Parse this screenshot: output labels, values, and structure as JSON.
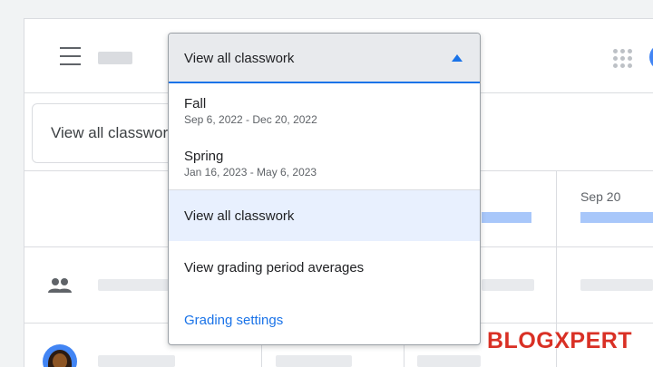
{
  "filter": {
    "label": "View all classwork"
  },
  "dropdown": {
    "selected": "View all classwork",
    "options": [
      {
        "label": "Fall",
        "dates": "Sep 6, 2022 - Dec 20, 2022"
      },
      {
        "label": "Spring",
        "dates": "Jan 16, 2023 - May 6, 2023"
      }
    ],
    "view_all": "View all classwork",
    "view_averages": "View grading period averages",
    "settings": "Grading settings"
  },
  "grid": {
    "column_date": "Sep 20"
  },
  "icons": {
    "menu": "hamburger-menu-icon",
    "apps": "apps-grid-icon",
    "caret": "caret-up-icon",
    "people": "people-icon"
  },
  "colors": {
    "accent": "#1a73e8",
    "highlight": "#e8f0fe",
    "watermark": "#d93025"
  },
  "watermark": "BLOGXPERT"
}
